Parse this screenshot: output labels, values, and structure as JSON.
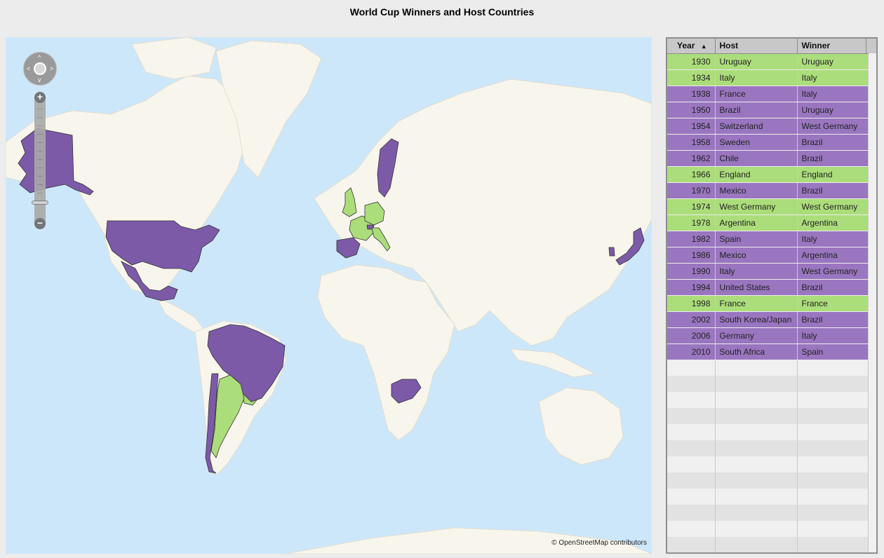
{
  "title": "World Cup Winners and Host Countries",
  "map": {
    "attribution": "© OpenStreetMap contributors",
    "colors": {
      "water": "#cde7fa",
      "land": "#f8f6ec",
      "winner_host": "#acdd7b",
      "host": "#7c5aa8",
      "border": "#333333"
    },
    "controls": {
      "pan": "pan-control",
      "zoom_in": "+",
      "zoom_out": "−"
    }
  },
  "table": {
    "columns": [
      "Year",
      "Host",
      "Winner"
    ],
    "sort_indicator": "▲",
    "rows": [
      {
        "year": "1930",
        "host": "Uruguay",
        "winner": "Uruguay",
        "highlight": "green"
      },
      {
        "year": "1934",
        "host": "Italy",
        "winner": "Italy",
        "highlight": "green"
      },
      {
        "year": "1938",
        "host": "France",
        "winner": "Italy",
        "highlight": "purple"
      },
      {
        "year": "1950",
        "host": "Brazil",
        "winner": "Uruguay",
        "highlight": "purple"
      },
      {
        "year": "1954",
        "host": "Switzerland",
        "winner": "West Germany",
        "highlight": "purple"
      },
      {
        "year": "1958",
        "host": "Sweden",
        "winner": "Brazil",
        "highlight": "purple"
      },
      {
        "year": "1962",
        "host": "Chile",
        "winner": "Brazil",
        "highlight": "purple"
      },
      {
        "year": "1966",
        "host": "England",
        "winner": "England",
        "highlight": "green"
      },
      {
        "year": "1970",
        "host": "Mexico",
        "winner": "Brazil",
        "highlight": "purple"
      },
      {
        "year": "1974",
        "host": "West Germany",
        "winner": "West Germany",
        "highlight": "green"
      },
      {
        "year": "1978",
        "host": "Argentina",
        "winner": "Argentina",
        "highlight": "green"
      },
      {
        "year": "1982",
        "host": "Spain",
        "winner": "Italy",
        "highlight": "purple"
      },
      {
        "year": "1986",
        "host": "Mexico",
        "winner": "Argentina",
        "highlight": "purple"
      },
      {
        "year": "1990",
        "host": "Italy",
        "winner": "West Germany",
        "highlight": "purple"
      },
      {
        "year": "1994",
        "host": "United States",
        "winner": "Brazil",
        "highlight": "purple"
      },
      {
        "year": "1998",
        "host": "France",
        "winner": "France",
        "highlight": "green"
      },
      {
        "year": "2002",
        "host": "South Korea/Japan",
        "winner": "Brazil",
        "highlight": "purple"
      },
      {
        "year": "2006",
        "host": "Germany",
        "winner": "Italy",
        "highlight": "purple"
      },
      {
        "year": "2010",
        "host": "South Africa",
        "winner": "Spain",
        "highlight": "purple"
      }
    ]
  }
}
